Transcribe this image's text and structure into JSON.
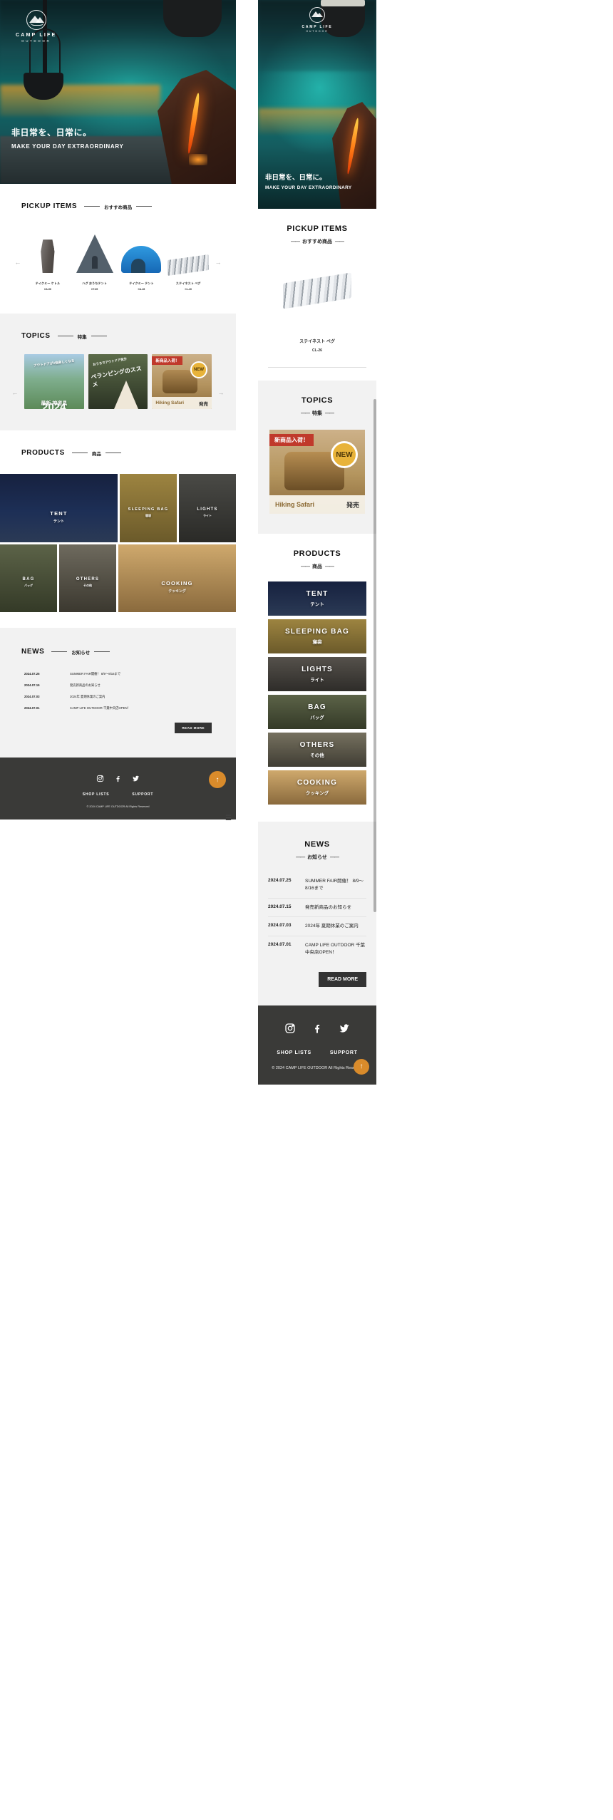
{
  "brand": {
    "name": "CAMP LIFE",
    "sub": "OUTDOOR"
  },
  "hero": {
    "headline_jp": "非日常を、日常に。",
    "headline_en": "MAKE YOUR DAY EXTRAORDINARY"
  },
  "sections": {
    "pickup": {
      "en": "PICKUP ITEMS",
      "jp": "おすすめ商品"
    },
    "topics": {
      "en": "TOPICS",
      "jp": "特集"
    },
    "products": {
      "en": "PRODUCTS",
      "jp": "商品"
    },
    "news": {
      "en": "NEWS",
      "jp": "お知らせ"
    }
  },
  "pickup_items": [
    {
      "name": "テイクミー ケトル",
      "code": "CA-56"
    },
    {
      "name": "ハグ おうちテント",
      "code": "CT-65"
    },
    {
      "name": "テイクミー テント",
      "code": "CA-28"
    },
    {
      "name": "ステイネスト ペグ",
      "code": "CL-26"
    }
  ],
  "pickup_featured": {
    "name": "ステイネスト ペグ",
    "code": "CL-26"
  },
  "topics": [
    {
      "sub": "アウトドアが3倍楽しくなる",
      "caption": "最新 神道具",
      "year": "2024"
    },
    {
      "sub": "おうちでアウトドア気分",
      "caption": "ベランピングのススメ"
    },
    {
      "ribbon": "新商品入荷！",
      "badge": "NEW",
      "left": "Hiking Safari",
      "right": "発売"
    }
  ],
  "products": [
    {
      "en": "TENT",
      "jp": "テント"
    },
    {
      "en": "SLEEPING BAG",
      "jp": "寝袋"
    },
    {
      "en": "LIGHTS",
      "jp": "ライト"
    },
    {
      "en": "BAG",
      "jp": "バッグ"
    },
    {
      "en": "OTHERS",
      "jp": "その他"
    },
    {
      "en": "COOKING",
      "jp": "クッキング"
    }
  ],
  "news": {
    "items": [
      {
        "date": "2024.07.25",
        "title": "SUMMER FAIR開催！ 8/9〜8/16まで"
      },
      {
        "date": "2024.07.15",
        "title": "発売新商品のお知らせ"
      },
      {
        "date": "2024.07.03",
        "title": "2024年 夏期休業のご案内"
      },
      {
        "date": "2024.07.01",
        "title": "CAMP LIFE OUTDOOR 千葉中央店OPEN！"
      }
    ],
    "more_label": "READ MORE"
  },
  "footer": {
    "social": [
      {
        "name": "instagram-icon",
        "glyph": "▣"
      },
      {
        "name": "facebook-icon",
        "glyph": "f"
      },
      {
        "name": "twitter-icon",
        "glyph": "✦"
      }
    ],
    "nav": [
      "SHOP LISTS",
      "SUPPORT"
    ],
    "copyright": "© 2024 CAMP LIFE OUTDOOR All Rights Reserved",
    "to_top": "↑",
    "menu": "☰"
  },
  "controls": {
    "prev": "←",
    "next": "→"
  },
  "colors": {
    "accent": "#d98b2b",
    "footer": "#3a3a38",
    "band": "#f2f2f2",
    "ribbon": "#c0392b"
  }
}
